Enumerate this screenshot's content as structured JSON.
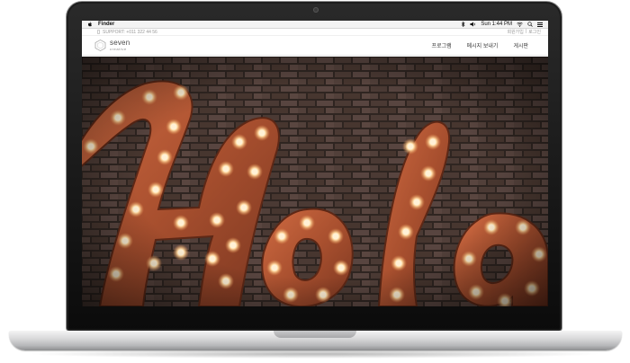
{
  "menubar": {
    "app_name": "Finder",
    "clock": "Sun 1:44 PM",
    "icons": [
      "apple-icon",
      "bluetooth-icon",
      "volume-icon",
      "wifi-icon",
      "search-icon",
      "list-icon"
    ]
  },
  "utility": {
    "support_text": "SUPPORT: +011 322 44 56",
    "right_links": [
      "회원가입",
      "|",
      "로그인"
    ]
  },
  "site": {
    "logo_name": "seven",
    "logo_sub": "creative",
    "nav": [
      "프로그램",
      "메시지 보내기",
      "게시판"
    ]
  },
  "hero": {
    "sign_text": "Hola",
    "colors": {
      "brick_dark": "#2f2521",
      "brick_light": "#5a4640",
      "letter_rust": "#b8593a",
      "bulb": "#ffe6c0"
    }
  }
}
